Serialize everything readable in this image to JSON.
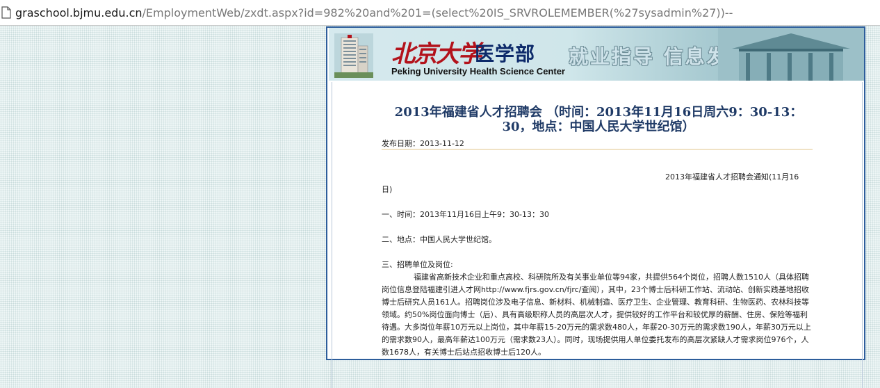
{
  "address_bar": {
    "host": "graschool.bjmu.edu.cn",
    "path": "/EmploymentWeb/zxdt.aspx?id=982%20and%201=(select%20IS_SRVROLEMEMBER(%27sysadmin%27))--"
  },
  "banner": {
    "pku_script": "北京大学",
    "pku_medical": "医学部",
    "english_name": "Peking University Health Science Center",
    "slogan": "就业指导  信息发布"
  },
  "article": {
    "title": "2013年福建省人才招聘会 （时间：2013年11月16日周六9：30-13：30，地点：中国人民大学世纪馆）",
    "publish_date": "发布日期：2013-11-12",
    "notice_line1": "2013年福建省人才招聘会通知(11月16",
    "notice_line2": "日)",
    "section1": "一、时间：2013年11月16日上午9：30-13：30",
    "section2": "二、地点：中国人民大学世纪馆。",
    "section3_heading": "三、招聘单位及岗位:",
    "section3_body": "福建省高新技术企业和重点高校、科研院所及有关事业单位等94家，共提供564个岗位，招聘人数1510人（具体招聘岗位信息登陆福建引进人才网http://www.fjrs.gov.cn/fjrc/查阅），其中，23个博士后科研工作站、流动站、创新实践基地招收博士后研究人员161人。招聘岗位涉及电子信息、新材料、机械制造、医疗卫生、企业管理、教育科研、生物医药、农林科技等领域。约50%岗位面向博士（后）、具有高级职称人员的高层次人才，提供较好的工作平台和较优厚的薪酬、住房、保险等福利待遇。大多岗位年薪10万元以上岗位，其中年薪15-20万元的需求数480人，年薪20-30万元的需求数190人，年薪30万元以上的需求数90人，最高年薪达100万元（需求数23人）。同时，现场提供用人单位委托发布的高层次紧缺人才需求岗位976个，人数1678人，有关博士后站点招收博士后120人。"
  },
  "colors": {
    "frame_border": "#2d5d9b",
    "title_text": "#1f3a66",
    "divider": "#e0c58a",
    "logo_red": "#b3121b",
    "logo_blue": "#0d2a6a"
  }
}
